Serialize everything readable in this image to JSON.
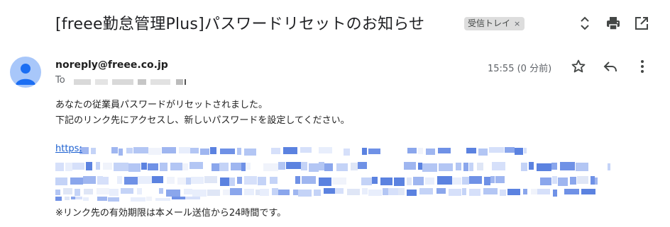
{
  "email": {
    "subject": "[freee勤怠管理Plus]パスワードリセットのお知らせ",
    "label": "受信トレイ",
    "label_close": "×",
    "sender": "noreply@freee.co.jp",
    "to_label": "To",
    "time": "15:55 (0 分前)",
    "body": {
      "line1": "あなたの従業員パスワードがリセットされました。",
      "line2": "下記のリンク先にアクセスし、新しいパスワードを設定してください。",
      "link_visible": "https:",
      "footer": "※リンク先の有効期限は本メール送信から24時間です。"
    }
  },
  "icons": {
    "expand": "unfold-icon",
    "print": "print-icon",
    "open_new": "open-in-new-icon",
    "star": "star-icon",
    "reply": "reply-icon",
    "more": "more-vert-icon",
    "avatar": "person-icon"
  },
  "colors": {
    "link": "#1a5fd0",
    "label_chip": "#dddddd",
    "avatar_bg": "#a8c7fa",
    "avatar_fg": "#1b6ef3"
  }
}
